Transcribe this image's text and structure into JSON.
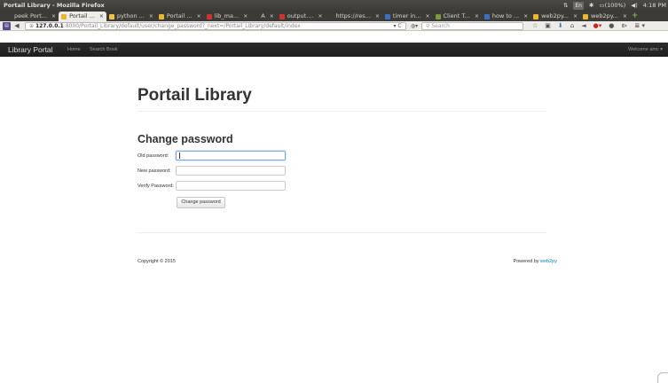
{
  "window": {
    "title": "Portail Library - Mozilla Firefox",
    "tray": {
      "kbd": "En",
      "battery": "(100%)",
      "time": "4:18 PM"
    }
  },
  "tabs": [
    {
      "label": "peek Port...",
      "active": false,
      "color": "#3c3b37"
    },
    {
      "label": "Portail ...",
      "active": true,
      "color": "#e8b830"
    },
    {
      "label": "python ...",
      "active": false,
      "color": "#f0c040"
    },
    {
      "label": "Portail ...",
      "active": false,
      "color": "#e8b830"
    },
    {
      "label": "lib_ma...",
      "active": false,
      "color": "#cc3333"
    },
    {
      "label": "A",
      "active": false,
      "color": "#3c3b37"
    },
    {
      "label": "output....",
      "active": false,
      "color": "#cc3333"
    },
    {
      "label": "https://res...",
      "active": false,
      "color": "#3c3b37"
    },
    {
      "label": "timer in...",
      "active": false,
      "color": "#3b6fc2"
    },
    {
      "label": "Client T...",
      "active": false,
      "color": "#7a9a3a"
    },
    {
      "label": "how to ...",
      "active": false,
      "color": "#3b6fc2"
    },
    {
      "label": "web2py...",
      "active": false,
      "color": "#e8b830"
    },
    {
      "label": "web2py...",
      "active": false,
      "color": "#e8b830"
    }
  ],
  "urlbar": {
    "host": "127.0.0.1",
    "rest": ":8000/Portail_Library/default/user/change_password?_next=/Portail_Library/default/index"
  },
  "searchbar": {
    "placeholder": "Search"
  },
  "app": {
    "brand": "Library Portal",
    "nav": [
      "Home",
      "Search Book"
    ],
    "welcome": "Welcome amc ▾"
  },
  "page": {
    "title": "Portail Library",
    "section": "Change password",
    "fields": [
      {
        "label": "Old password:",
        "value": ""
      },
      {
        "label": "New password:",
        "value": ""
      },
      {
        "label": "Verify Password:",
        "value": ""
      }
    ],
    "submit": "Change password",
    "copyright": "Copyright © 2015",
    "powered_prefix": "Powered by ",
    "powered_link": "web2py"
  },
  "colors": {
    "link": "#0088cc",
    "navbar_bg": "#222222"
  }
}
